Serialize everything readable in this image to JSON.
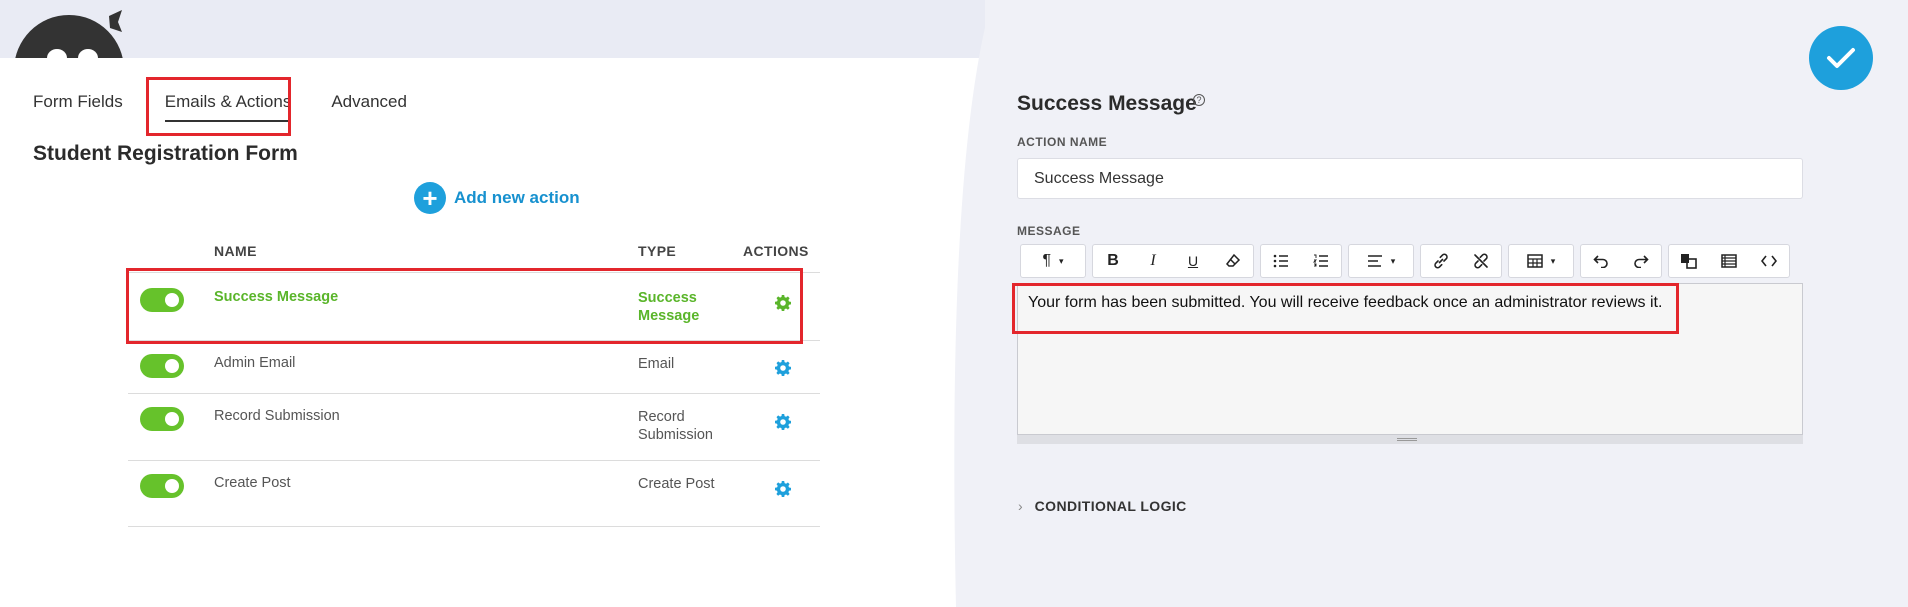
{
  "tabs": [
    {
      "label": "Form Fields"
    },
    {
      "label": "Emails & Actions"
    },
    {
      "label": "Advanced"
    }
  ],
  "form_title": "Student Registration Form",
  "add_action_label": "Add new action",
  "table": {
    "headers": {
      "name": "NAME",
      "type": "TYPE",
      "actions": "ACTIONS"
    },
    "rows": [
      {
        "name": "Success Message",
        "type": "Success Message",
        "enabled": true
      },
      {
        "name": "Admin Email",
        "type": "Email",
        "enabled": true
      },
      {
        "name": "Record Submission",
        "type": "Record Submission",
        "enabled": true
      },
      {
        "name": "Create Post",
        "type": "Create Post",
        "enabled": true
      }
    ]
  },
  "panel": {
    "title": "Success Message",
    "help": "?",
    "action_name_label": "ACTION NAME",
    "action_name_value": "Success Message",
    "message_label": "MESSAGE",
    "message_text": "Your form has been submitted. You will receive feedback once an administrator reviews it.",
    "conditional_logic_label": "CONDITIONAL LOGIC"
  },
  "toolbar": {
    "paragraph": "¶",
    "bold": "B",
    "italic": "I",
    "underline": "U",
    "caret": "▾"
  },
  "colors": {
    "accent": "#1ea0dc",
    "toggle_on": "#66c22b",
    "active_text": "#5ab52a",
    "highlight_box": "#e3262c"
  }
}
